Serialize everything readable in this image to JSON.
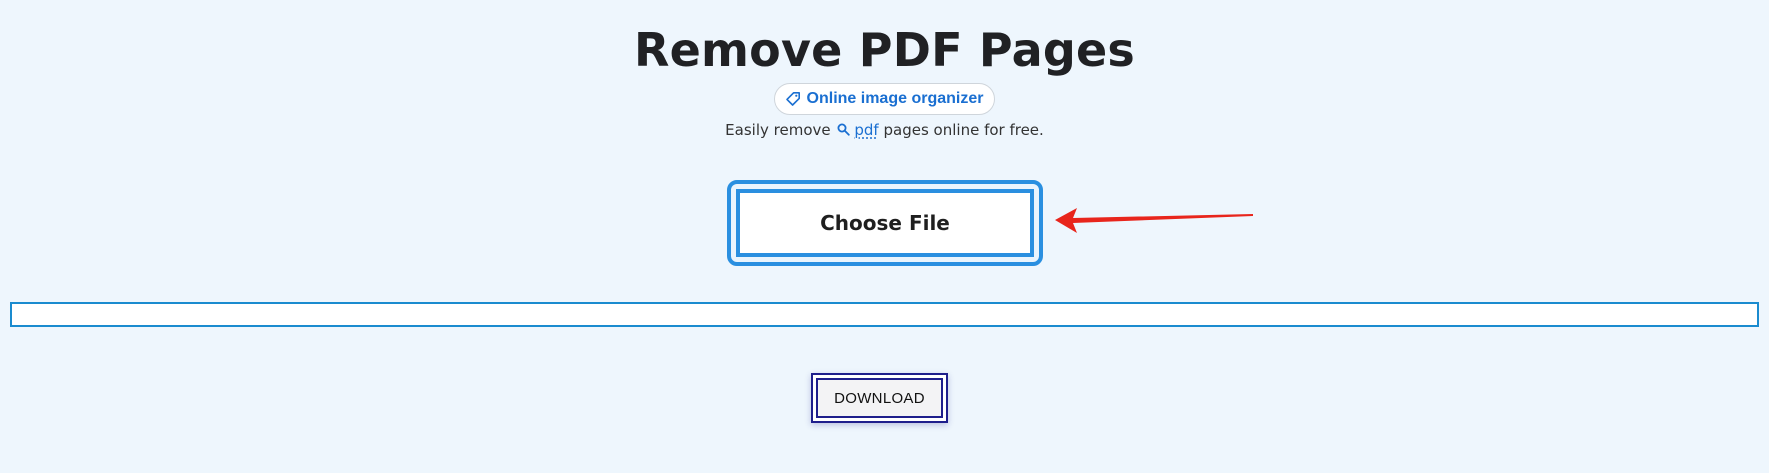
{
  "page": {
    "title": "Remove PDF Pages",
    "tag": {
      "label": "Online image organizer",
      "icon": "tag-icon"
    },
    "subtitle": {
      "prefix": "Easily remove",
      "link_text": "pdf",
      "suffix": "pages online for free.",
      "icon": "search-icon"
    }
  },
  "upload": {
    "button_label": "Choose File"
  },
  "progress": {
    "value": 0
  },
  "actions": {
    "download_label": "DOWNLOAD"
  },
  "colors": {
    "background": "#eef6fd",
    "accent_blue": "#2a8fe0",
    "link_blue": "#1a6fd1",
    "progress_border": "#1a8bcf",
    "download_border": "#1e1e8c",
    "arrow_red": "#e8251c"
  }
}
